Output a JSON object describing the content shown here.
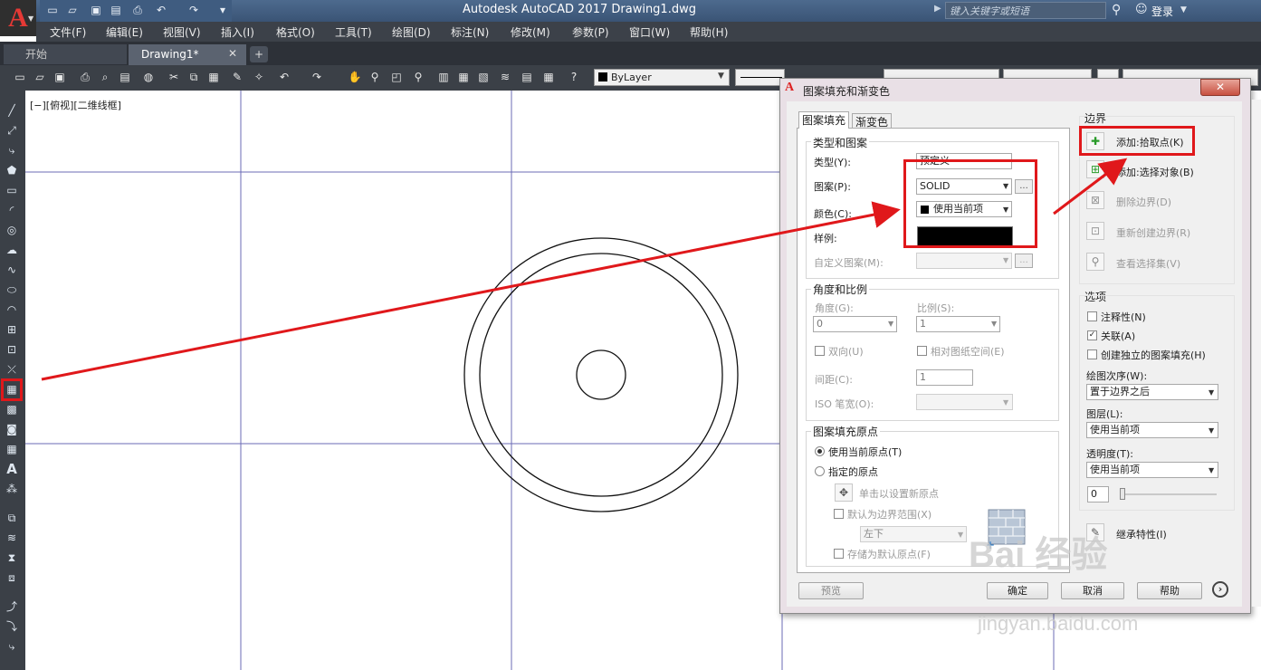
{
  "app": {
    "title": "Autodesk AutoCAD 2017    Drawing1.dwg",
    "search_placeholder": "键入关键字或短语",
    "login": "登录",
    "logo": "A"
  },
  "menus": [
    "文件(F)",
    "编辑(E)",
    "视图(V)",
    "插入(I)",
    "格式(O)",
    "工具(T)",
    "绘图(D)",
    "标注(N)",
    "修改(M)",
    "参数(P)",
    "窗口(W)",
    "帮助(H)"
  ],
  "tabs": {
    "start": "开始",
    "drawing": "Drawing1*",
    "close": "✕",
    "add": "+"
  },
  "toolbar": {
    "layer": "ByLayer"
  },
  "viewport": {
    "label": "[−][俯视][二维线框]"
  },
  "dialog": {
    "title": "图案填充和渐变色",
    "close": "✕",
    "tabs": [
      "图案填充",
      "渐变色"
    ],
    "type_pattern": {
      "title": "类型和图案",
      "type_label": "类型(Y):",
      "type_value": "预定义",
      "pattern_label": "图案(P):",
      "pattern_value": "SOLID",
      "color_label": "颜色(C):",
      "color_value": "使用当前项",
      "sample_label": "样例:",
      "custom_label": "自定义图案(M):",
      "ellipsis": "..."
    },
    "angle_scale": {
      "title": "角度和比例",
      "angle_label": "角度(G):",
      "angle_value": "0",
      "scale_label": "比例(S):",
      "scale_value": "1",
      "double_label": "双向(U)",
      "relative_label": "相对图纸空间(E)",
      "spacing_label": "间距(C):",
      "spacing_value": "1",
      "iso_label": "ISO 笔宽(O):"
    },
    "origin": {
      "title": "图案填充原点",
      "current_label": "使用当前原点(T)",
      "specified_label": "指定的原点",
      "click_label": "单击以设置新原点",
      "default_label": "默认为边界范围(X)",
      "position_value": "左下",
      "store_label": "存储为默认原点(F)"
    },
    "boundary": {
      "title": "边界",
      "add_pick": "添加:拾取点(K)",
      "add_select": "添加:选择对象(B)",
      "remove": "删除边界(D)",
      "recreate": "重新创建边界(R)",
      "view": "查看选择集(V)"
    },
    "options": {
      "title": "选项",
      "annotative": "注释性(N)",
      "associative": "关联(A)",
      "separate": "创建独立的图案填充(H)",
      "draw_order_label": "绘图次序(W):",
      "draw_order_value": "置于边界之后",
      "layer_label": "图层(L):",
      "layer_value": "使用当前项",
      "transparency_label": "透明度(T):",
      "transparency_value": "使用当前项",
      "transparency_amount": "0"
    },
    "inherit": "继承特性(I)",
    "buttons": {
      "preview": "预览",
      "ok": "确定",
      "cancel": "取消",
      "help": "帮助"
    }
  },
  "watermark": {
    "brand": "Bai 经验",
    "url": "jingyan.baidu.com"
  },
  "colors": {
    "annotation_red": "#e0181b",
    "titlebar": "#4d6a8e",
    "dark_ui": "#3b4047"
  }
}
